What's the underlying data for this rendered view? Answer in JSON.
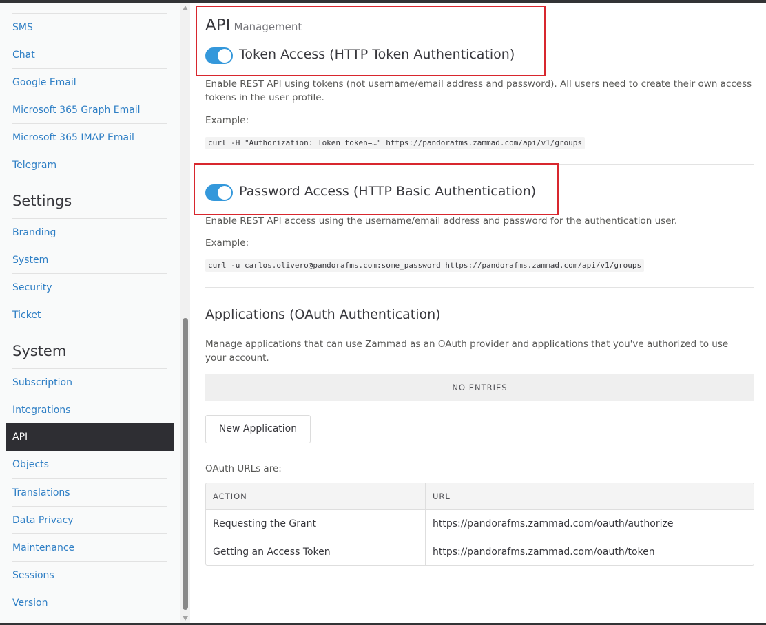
{
  "sidebar": {
    "channels_items": [
      {
        "label": "SMS"
      },
      {
        "label": "Chat"
      },
      {
        "label": "Google Email"
      },
      {
        "label": "Microsoft 365 Graph Email"
      },
      {
        "label": "Microsoft 365 IMAP Email"
      },
      {
        "label": "Telegram"
      }
    ],
    "settings_header": "Settings",
    "settings_items": [
      {
        "label": "Branding"
      },
      {
        "label": "System"
      },
      {
        "label": "Security"
      },
      {
        "label": "Ticket"
      }
    ],
    "system_header": "System",
    "system_items": [
      {
        "label": "Subscription"
      },
      {
        "label": "Integrations"
      },
      {
        "label": "API",
        "active": true
      },
      {
        "label": "Objects"
      },
      {
        "label": "Translations"
      },
      {
        "label": "Data Privacy"
      },
      {
        "label": "Maintenance"
      },
      {
        "label": "Sessions"
      },
      {
        "label": "Version"
      }
    ]
  },
  "main": {
    "title": "API",
    "subtitle": "Management",
    "token_access": {
      "title": "Token Access (HTTP Token Authentication)",
      "enabled": true,
      "description": "Enable REST API using tokens (not username/email address and password). All users need to create their own access tokens in the user profile.",
      "example_label": "Example:",
      "example_code": "curl -H \"Authorization: Token token=…\" https://pandorafms.zammad.com/api/v1/groups"
    },
    "password_access": {
      "title": "Password Access (HTTP Basic Authentication)",
      "enabled": true,
      "description": "Enable REST API access using the username/email address and password for the authentication user.",
      "example_label": "Example:",
      "example_code": "curl -u carlos.olivero@pandorafms.com:some_password https://pandorafms.zammad.com/api/v1/groups"
    },
    "applications": {
      "title": "Applications (OAuth Authentication)",
      "description": "Manage applications that can use Zammad as an OAuth provider and applications that you've authorized to use your account.",
      "no_entries": "NO ENTRIES",
      "new_button": "New Application",
      "oauth_label": "OAuth URLs are:",
      "table": {
        "headers": [
          "ACTION",
          "URL"
        ],
        "rows": [
          {
            "action": "Requesting the Grant",
            "url": "https://pandorafms.zammad.com/oauth/authorize"
          },
          {
            "action": "Getting an Access Token",
            "url": "https://pandorafms.zammad.com/oauth/token"
          }
        ]
      }
    }
  },
  "colors": {
    "link": "#2f7fc5",
    "active_nav_bg": "#2e2e33",
    "toggle_on": "#3498db",
    "highlight_box": "#d8272e"
  }
}
